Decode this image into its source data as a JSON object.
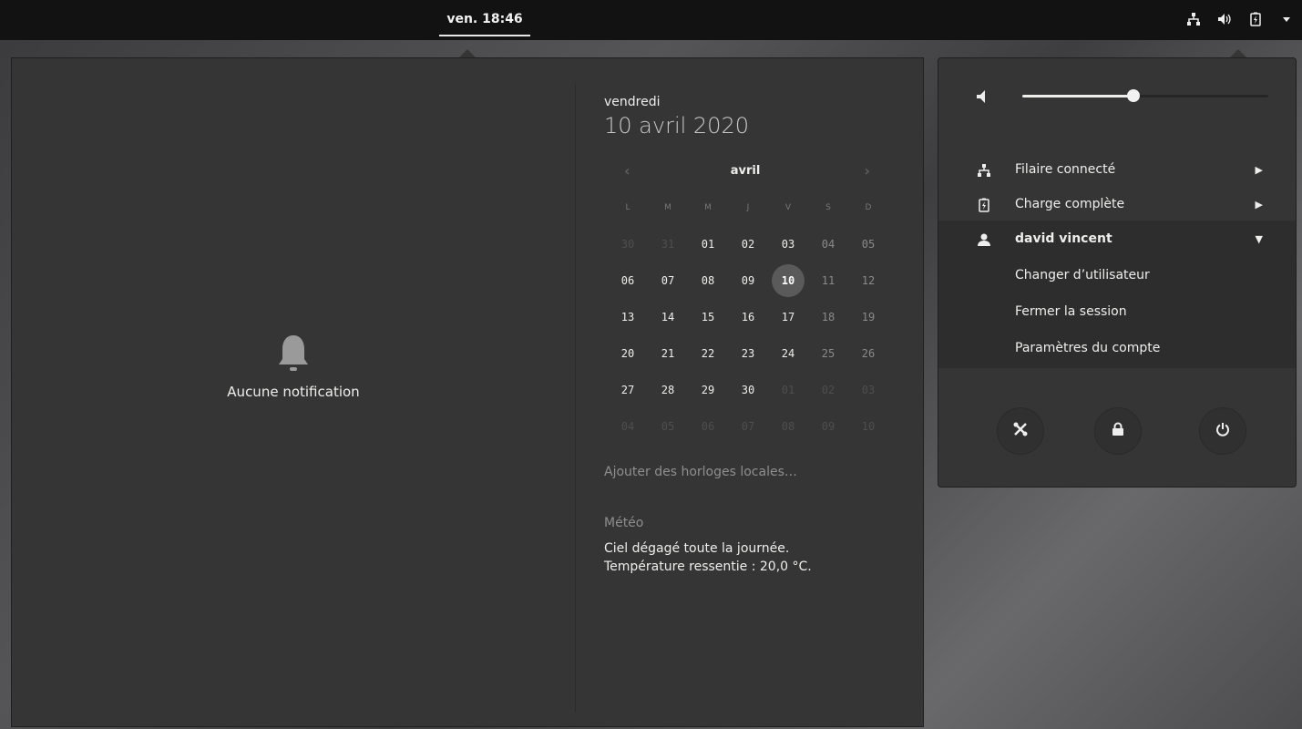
{
  "topbar": {
    "clock": "ven. 18:46"
  },
  "notifications": {
    "empty_label": "Aucune notification"
  },
  "calendar": {
    "day_name": "vendredi",
    "full_date": "10 avril 2020",
    "month": "avril",
    "prev_label": "‹",
    "next_label": "›",
    "weekdays": [
      "L",
      "M",
      "M",
      "J",
      "V",
      "S",
      "D"
    ],
    "weeks": [
      [
        "30",
        "31",
        "01",
        "02",
        "03",
        "04",
        "05"
      ],
      [
        "06",
        "07",
        "08",
        "09",
        "10",
        "11",
        "12"
      ],
      [
        "13",
        "14",
        "15",
        "16",
        "17",
        "18",
        "19"
      ],
      [
        "20",
        "21",
        "22",
        "23",
        "24",
        "25",
        "26"
      ],
      [
        "27",
        "28",
        "29",
        "30",
        "01",
        "02",
        "03"
      ],
      [
        "04",
        "05",
        "06",
        "07",
        "08",
        "09",
        "10"
      ]
    ],
    "today": "10",
    "add_clocks": "Ajouter des horloges locales…",
    "weather_title": "Météo",
    "weather_line1": "Ciel dégagé toute la journée.",
    "weather_line2": "Température ressentie : 20,0 °C."
  },
  "system_menu": {
    "volume_percent": 45,
    "wired": "Filaire connecté",
    "battery": "Charge complète",
    "user": "david vincent",
    "switch_user": "Changer d’utilisateur",
    "logout": "Fermer la session",
    "account_settings": "Paramètres du compte"
  },
  "colors": {
    "panel": "#353535",
    "topbar": "#121212",
    "text": "#eeeeec"
  }
}
